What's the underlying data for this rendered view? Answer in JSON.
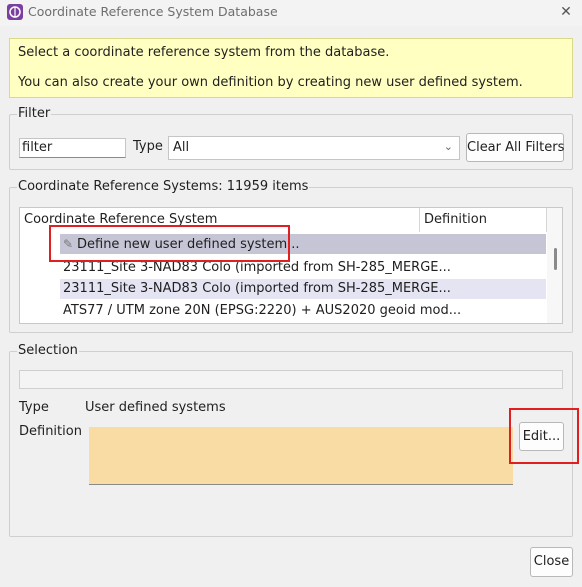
{
  "window": {
    "title": "Coordinate Reference System Database",
    "close_glyph": "✕"
  },
  "banner": {
    "line1": "Select a coordinate reference system from the database.",
    "line2": "You can also create your own definition by creating new user defined system."
  },
  "filter": {
    "group_title": "Filter",
    "input_value": "filter",
    "type_label": "Type",
    "type_value": "All",
    "clear_button": "Clear All Filters"
  },
  "crs_list": {
    "group_title": "Coordinate Reference Systems: 11959 items",
    "columns": [
      "Coordinate Reference System",
      "Definition"
    ],
    "define_new": "Define new user defined system...",
    "rows": [
      "23111_Site 3-NAD83 Colo (imported from SH-285_MERGE...",
      "23111_Site 3-NAD83 Colo (imported from SH-285_MERGE...",
      "ATS77 / UTM zone 20N (EPSG:2220) + AUS2020 geoid mod..."
    ]
  },
  "selection": {
    "group_title": "Selection",
    "type_label": "Type",
    "type_value": "User defined systems",
    "definition_label": "Definition",
    "edit_button": "Edit..."
  },
  "footer": {
    "close_button": "Close"
  },
  "icons": {
    "app": "app-icon",
    "pencil": "pencil-icon",
    "chevron": "chevron-down-icon"
  },
  "colors": {
    "banner_bg": "#ffffc2",
    "definition_bg": "#f8dca4",
    "selected_row": "#c5c5d6",
    "highlight_row": "#e4e4f3",
    "annotation_red": "#e02020"
  }
}
